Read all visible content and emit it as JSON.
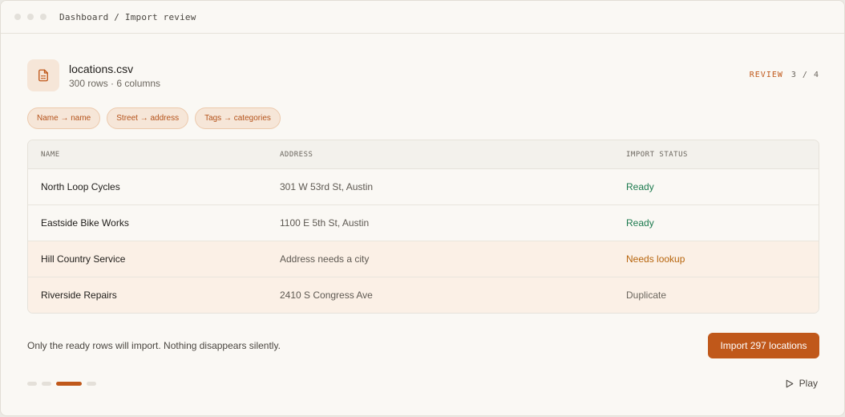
{
  "breadcrumb": "Dashboard / Import review",
  "file": {
    "name": "locations.csv",
    "meta": "300 rows · 6 columns"
  },
  "step": {
    "label": "REVIEW",
    "count": "3 / 4"
  },
  "chips": [
    "Name → name",
    "Street → address",
    "Tags → categories"
  ],
  "table": {
    "headers": [
      "NAME",
      "ADDRESS",
      "IMPORT STATUS"
    ],
    "rows": [
      {
        "name": "North Loop Cycles",
        "address": "301 W 53rd St, Austin",
        "status": "Ready"
      },
      {
        "name": "Eastside Bike Works",
        "address": "1100 E 5th St, Austin",
        "status": "Ready"
      },
      {
        "name": "Hill Country Service",
        "address": "Address needs a city",
        "status": "Needs lookup"
      },
      {
        "name": "Riverside Repairs",
        "address": "2410 S Congress Ave",
        "status": "Duplicate"
      }
    ]
  },
  "footnote": "Only the ready rows will import. Nothing disappears silently.",
  "import_button": "Import 297 locations",
  "progress": {
    "steps": 4,
    "current": 3
  },
  "play_label": "Play",
  "colors": {
    "accent": "#c0581a",
    "ready": "#1c7a4e",
    "lookup": "#b7650d",
    "duplicate": "#6b665e"
  },
  "icons": {
    "file": "file-spreadsheet-icon",
    "play": "play-icon"
  }
}
